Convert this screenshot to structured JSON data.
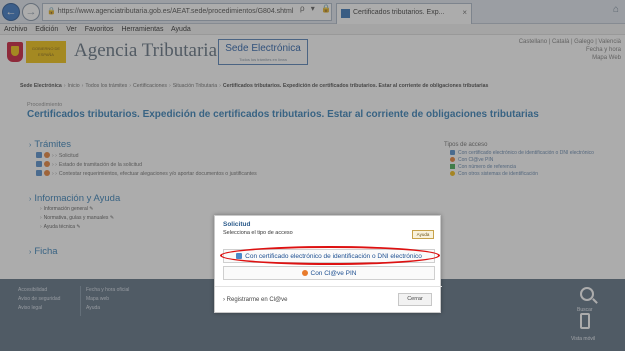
{
  "browser": {
    "url": "https://www.agenciatributaria.gob.es/AEAT.sede/procedimientos/G804.shtml",
    "tab_title": "Certificados tributarios. Exp...",
    "tab_close": "×",
    "addr_tools": "ρ ▾ 🔒 C",
    "right_icons": "⌂"
  },
  "menubar": [
    "Archivo",
    "Edición",
    "Ver",
    "Favoritos",
    "Herramientas",
    "Ayuda"
  ],
  "header": {
    "gov_label": "GOBIERNO DE ESPAÑA",
    "agency_name": "Agencia Tributaria",
    "sede_title": "Sede Electrónica",
    "sede_sub": "Todos los trámites en línea",
    "languages": "Castellano | Català | Galego | Valencià",
    "date_info": "Fecha y hora",
    "site_map": "Mapa Web"
  },
  "breadcrumb": {
    "items": [
      "Sede Electrónica",
      "Inicio",
      "Todos los trámites",
      "Certificaciones",
      "Situación Tributaria",
      "Certificados tributarios. Expedición de certificados tributarios. Estar al corriente de obligaciones tributarias"
    ],
    "separator": "›"
  },
  "page": {
    "procedure_label": "Procedimiento",
    "title": "Certificados tributarios. Expedición de certificados tributarios. Estar al corriente de obligaciones tributarias"
  },
  "tramites": {
    "title": "Trámites",
    "items": [
      "Solicitud",
      "Estado de tramitación de la solicitud",
      "Contestar requerimientos, efectuar alegaciones y/o aportar documentos o justificantes"
    ]
  },
  "info": {
    "title": "Información y Ayuda",
    "items": [
      "Información general",
      "Normativa, guías y manuales",
      "Ayuda técnica"
    ]
  },
  "ficha": {
    "title": "Ficha"
  },
  "access_types": {
    "title": "Tipos de acceso",
    "items": [
      "Con certificado electrónico de identificación o DNI electrónico",
      "Con Cl@ve PIN",
      "Con número de referencia",
      "Con otros sistemas de identificación"
    ]
  },
  "footer": {
    "col1": [
      "Accesibilidad",
      "Aviso de seguridad",
      "Aviso legal"
    ],
    "col2": [
      "Fecha y hora oficial",
      "Mapa web",
      "Ayuda"
    ],
    "search_label": "Buscar",
    "mobile_label": "Vista móvil"
  },
  "modal": {
    "title": "Solicitud",
    "subtitle": "Selecciona el tipo de acceso",
    "help_label": "Ayuda",
    "option_cert": "Con certificado electrónico de identificación o DNI electrónico",
    "option_pin": "Con Cl@ve PIN",
    "register_label": "› Registrarme en Cl@ve",
    "close_label": "Cerrar"
  },
  "colors": {
    "link_blue": "#2a78b3",
    "footer_bg": "#56697d",
    "highlight_red": "#dd1111"
  }
}
